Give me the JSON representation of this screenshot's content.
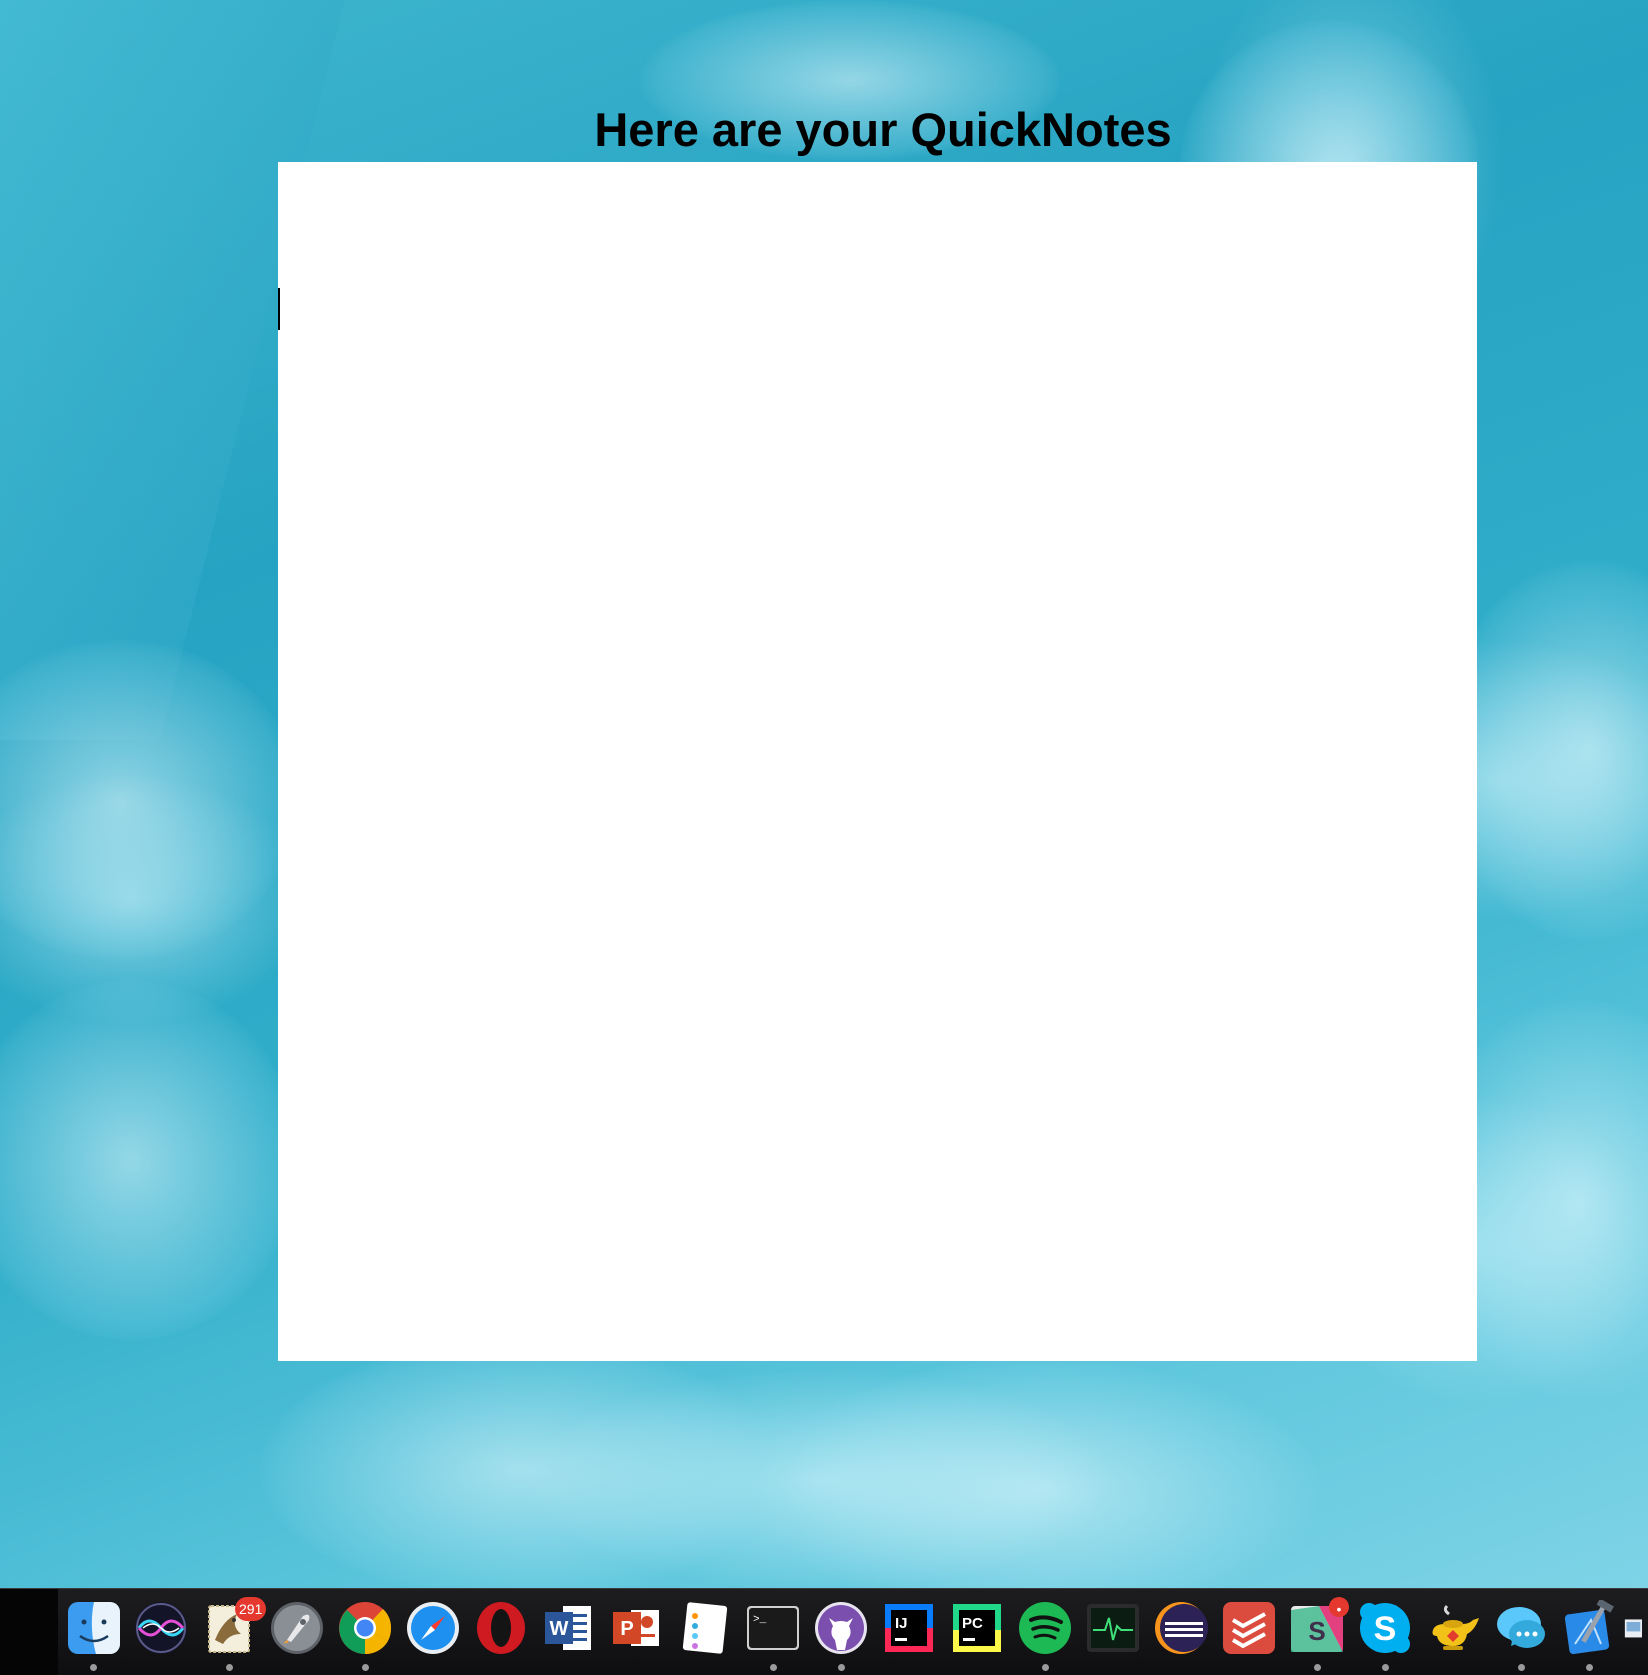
{
  "window": {
    "title": "Here are your QuickNotes"
  },
  "note": {
    "text": ""
  },
  "dock": {
    "items": [
      {
        "id": "finder",
        "icon": "finder-icon",
        "running": true
      },
      {
        "id": "siri",
        "icon": "siri-icon",
        "running": false
      },
      {
        "id": "mail",
        "icon": "mail-icon",
        "running": true,
        "badge": "291"
      },
      {
        "id": "launchpad",
        "icon": "rocket-icon",
        "running": false
      },
      {
        "id": "chrome",
        "icon": "chrome-icon",
        "running": true
      },
      {
        "id": "safari",
        "icon": "compass-icon",
        "running": false
      },
      {
        "id": "opera",
        "icon": "opera-icon",
        "running": false
      },
      {
        "id": "word",
        "icon": "word-icon",
        "running": false,
        "letter": "W"
      },
      {
        "id": "powerpoint",
        "icon": "powerpoint-icon",
        "running": false,
        "letter": "P"
      },
      {
        "id": "reminders",
        "icon": "reminders-icon",
        "running": false
      },
      {
        "id": "terminal",
        "icon": "terminal-icon",
        "running": true,
        "prompt": ">_"
      },
      {
        "id": "github",
        "icon": "octocat-icon",
        "running": true
      },
      {
        "id": "intellij",
        "icon": "intellij-icon",
        "running": false,
        "letter": "IJ"
      },
      {
        "id": "pycharm",
        "icon": "pycharm-icon",
        "running": false,
        "letter": "PC"
      },
      {
        "id": "spotify",
        "icon": "spotify-icon",
        "running": true
      },
      {
        "id": "activity-monitor",
        "icon": "activity-monitor-icon",
        "running": false
      },
      {
        "id": "eclipse",
        "icon": "eclipse-icon",
        "running": false
      },
      {
        "id": "todoist",
        "icon": "todoist-icon",
        "running": false
      },
      {
        "id": "slack",
        "icon": "slack-icon",
        "running": true,
        "letter": "S",
        "badge": "•"
      },
      {
        "id": "skype",
        "icon": "skype-icon",
        "running": true,
        "letter": "S"
      },
      {
        "id": "alfred",
        "icon": "genie-lamp-icon",
        "running": false
      },
      {
        "id": "messages",
        "icon": "messages-icon",
        "running": true
      },
      {
        "id": "xcode",
        "icon": "xcode-icon",
        "running": true
      },
      {
        "id": "preview",
        "icon": "preview-icon",
        "running": false
      }
    ]
  },
  "colors": {
    "desktop_base": "#2fadc9",
    "dock_background": "#1d1d1f",
    "badge": "#e5392f"
  }
}
